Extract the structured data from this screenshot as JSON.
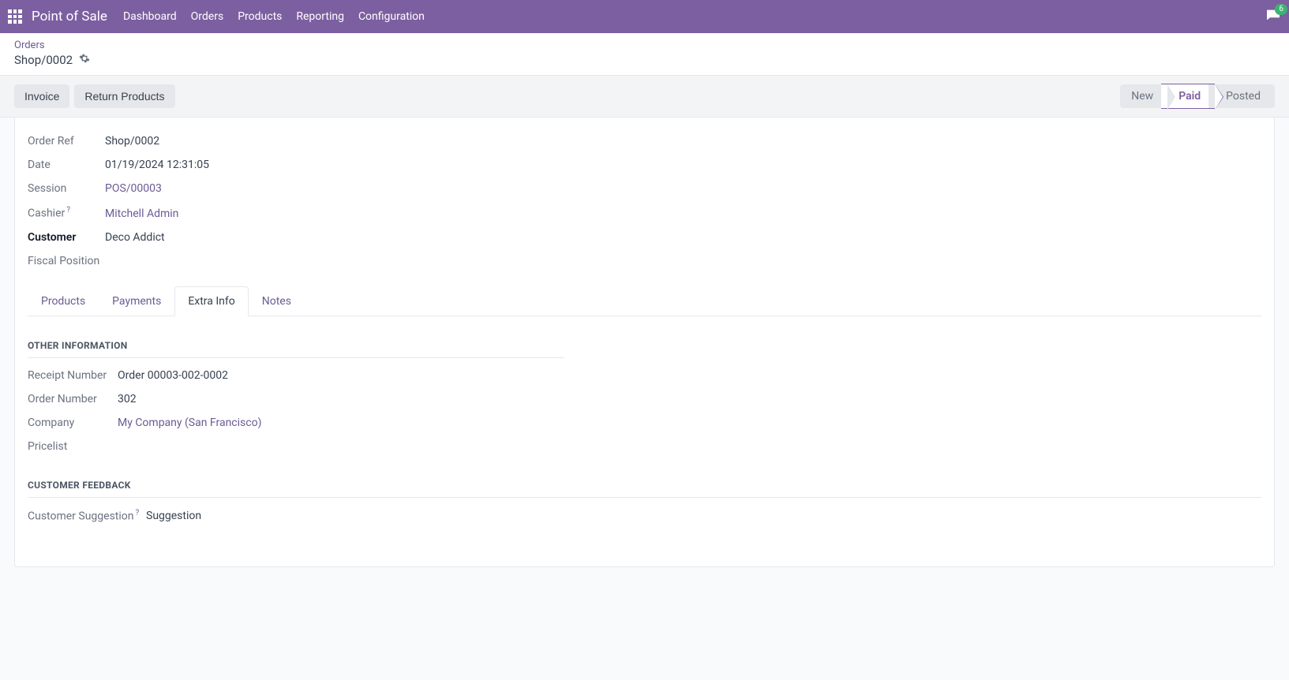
{
  "navbar": {
    "brand": "Point of Sale",
    "items": [
      "Dashboard",
      "Orders",
      "Products",
      "Reporting",
      "Configuration"
    ],
    "badge": "6"
  },
  "breadcrumb": {
    "parent": "Orders",
    "current": "Shop/0002"
  },
  "actions": {
    "invoice": "Invoice",
    "return_products": "Return Products"
  },
  "statuses": [
    "New",
    "Paid",
    "Posted"
  ],
  "active_status": "Paid",
  "fields": {
    "order_ref": {
      "label": "Order Ref",
      "value": "Shop/0002"
    },
    "date": {
      "label": "Date",
      "value": "01/19/2024 12:31:05"
    },
    "session": {
      "label": "Session",
      "value": "POS/00003"
    },
    "cashier": {
      "label": "Cashier",
      "value": "Mitchell Admin"
    },
    "customer": {
      "label": "Customer",
      "value": "Deco Addict"
    },
    "fiscal": {
      "label": "Fiscal Position",
      "value": ""
    }
  },
  "tabs": [
    "Products",
    "Payments",
    "Extra Info",
    "Notes"
  ],
  "active_tab": "Extra Info",
  "extra_info": {
    "section1_title": "OTHER INFORMATION",
    "receipt_number": {
      "label": "Receipt Number",
      "value": "Order 00003-002-0002"
    },
    "order_number": {
      "label": "Order Number",
      "value": "302"
    },
    "company": {
      "label": "Company",
      "value": "My Company (San Francisco)"
    },
    "pricelist": {
      "label": "Pricelist",
      "value": ""
    },
    "section2_title": "CUSTOMER FEEDBACK",
    "suggestion": {
      "label": "Customer Suggestion",
      "value": "Suggestion"
    }
  }
}
